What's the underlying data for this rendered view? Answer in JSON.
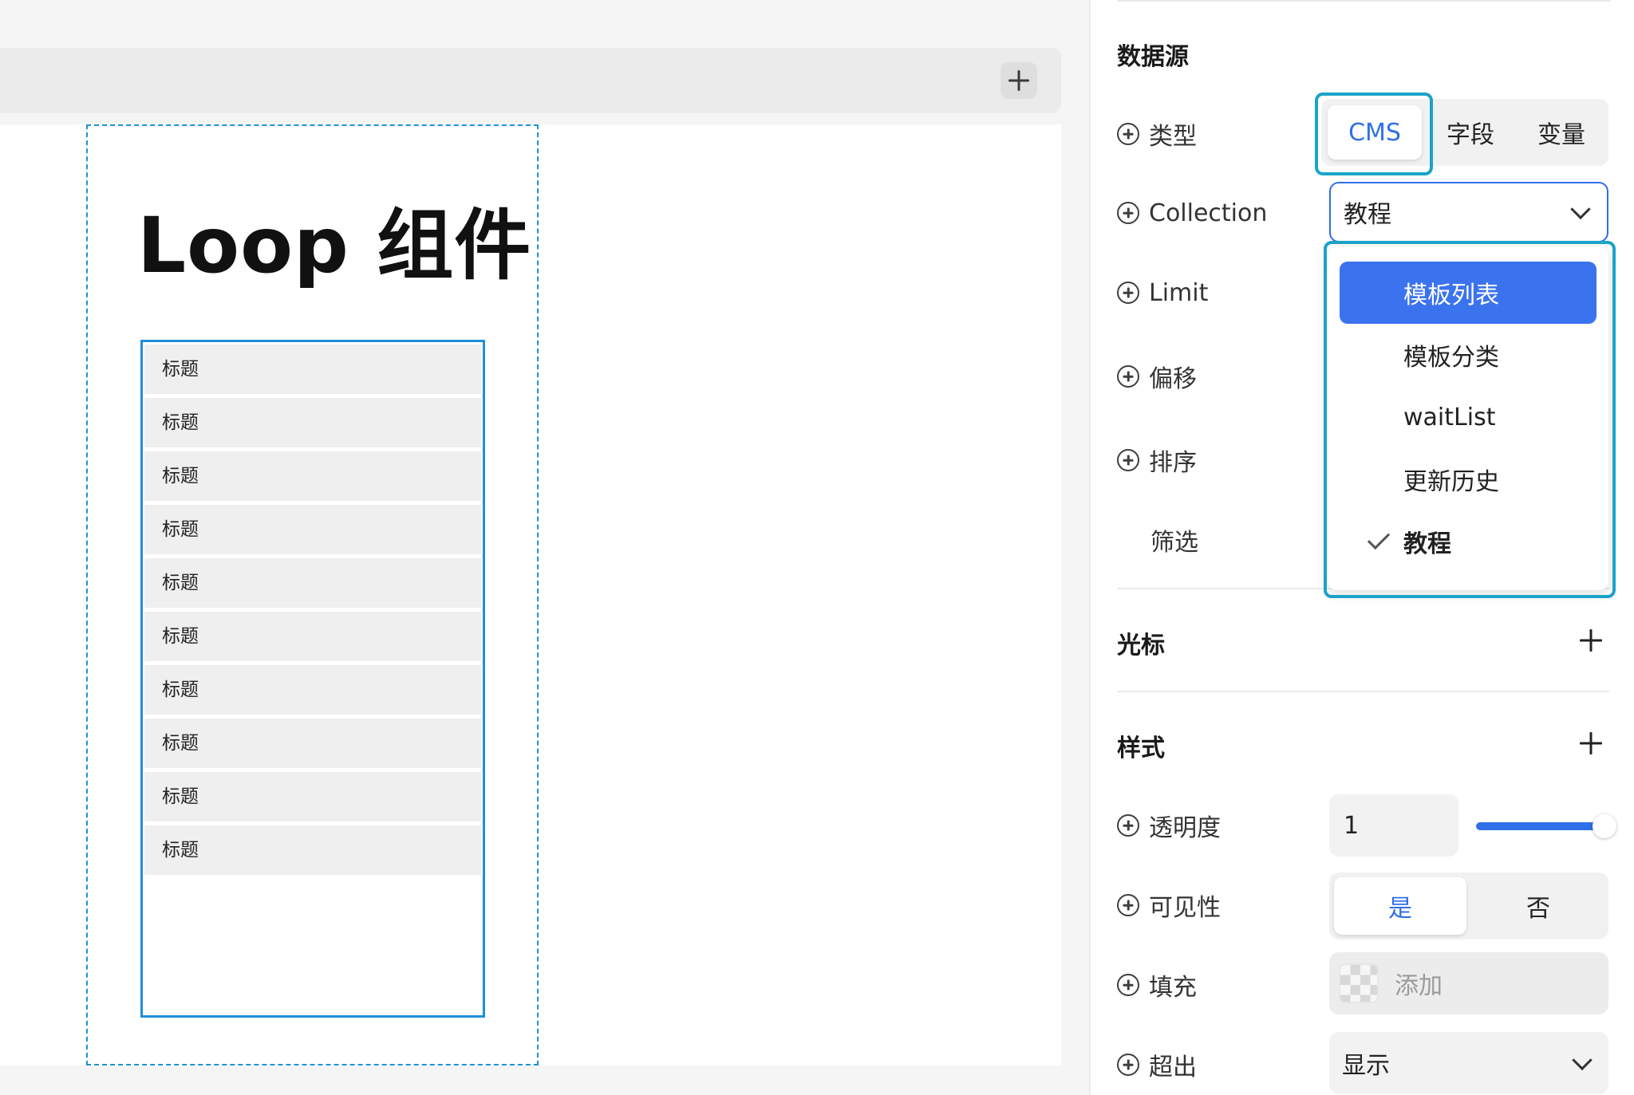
{
  "canvas": {
    "loop_title": "Loop 组件",
    "list_items": [
      "标题",
      "标题",
      "标题",
      "标题",
      "标题",
      "标题",
      "标题",
      "标题",
      "标题",
      "标题"
    ]
  },
  "panel": {
    "data_source": {
      "title": "数据源",
      "type_label": "类型",
      "type_options": [
        "CMS",
        "字段",
        "变量"
      ],
      "type_selected": "CMS",
      "collection_label": "Collection",
      "collection_value": "教程",
      "collection_options": [
        "模板列表",
        "模板分类",
        "waitList",
        "更新历史",
        "教程"
      ],
      "collection_highlighted": "模板列表",
      "collection_checked": "教程",
      "limit_label": "Limit",
      "offset_label": "偏移",
      "sort_label": "排序",
      "filter_label": "筛选"
    },
    "cursor": {
      "title": "光标"
    },
    "style": {
      "title": "样式",
      "opacity_label": "透明度",
      "opacity_value": "1",
      "opacity_level": 1.0,
      "visibility_label": "可见性",
      "visibility_options": [
        "是",
        "否"
      ],
      "visibility_selected": "是",
      "fill_label": "填充",
      "fill_placeholder": "添加",
      "overflow_label": "超出",
      "overflow_value": "显示"
    }
  },
  "colors": {
    "accent_blue": "#2f6fe8",
    "highlight_cyan": "#1ba3c9",
    "frame_blue": "#1f8fd8"
  }
}
